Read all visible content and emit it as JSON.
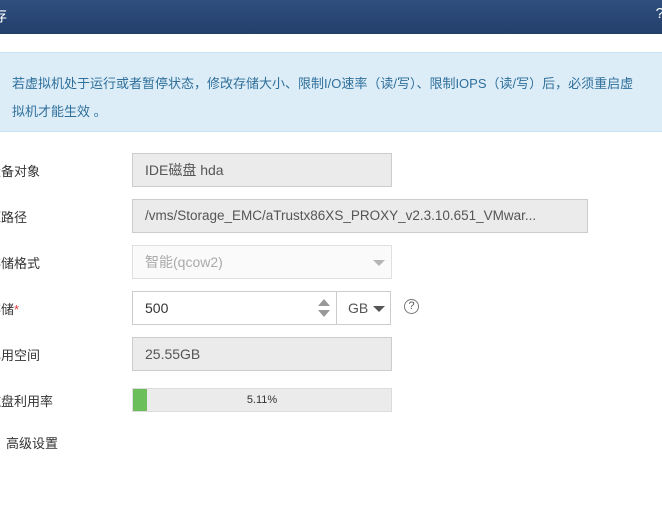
{
  "window": {
    "title_left_glyph": "存",
    "title_right_glyph": "?"
  },
  "notice": "若虚拟机处于运行或者暂停状态，修改存储大小、限制I/O速率（读/写）、限制IOPS（读/写）后，必须重启虚拟机才能生效 。",
  "form": {
    "device_object": {
      "label": "设备对象",
      "value": "IDE磁盘 hda"
    },
    "source_path": {
      "label": "源路径",
      "value": "/vms/Storage_EMC/aTrustx86XS_PROXY_v2.3.10.651_VMwar..."
    },
    "storage_format": {
      "label": "存储格式",
      "value": "智能(qcow2)"
    },
    "storage": {
      "label": "存储",
      "required_mark": "*",
      "value": "500",
      "unit": "GB",
      "help_glyph": "?"
    },
    "used_space": {
      "label": "已用空间",
      "value": "25.55GB"
    },
    "disk_usage": {
      "label": "磁盘利用率",
      "percent_text": "5.11%",
      "fraction": 0.0511
    },
    "advanced_label": "高级设置"
  },
  "colors": {
    "title_bar": "#2b4a7a",
    "notice_bg": "#dcedf8",
    "notice_text": "#2f6f9a",
    "progress_fill": "#6abf5a",
    "required": "#e4393c"
  }
}
